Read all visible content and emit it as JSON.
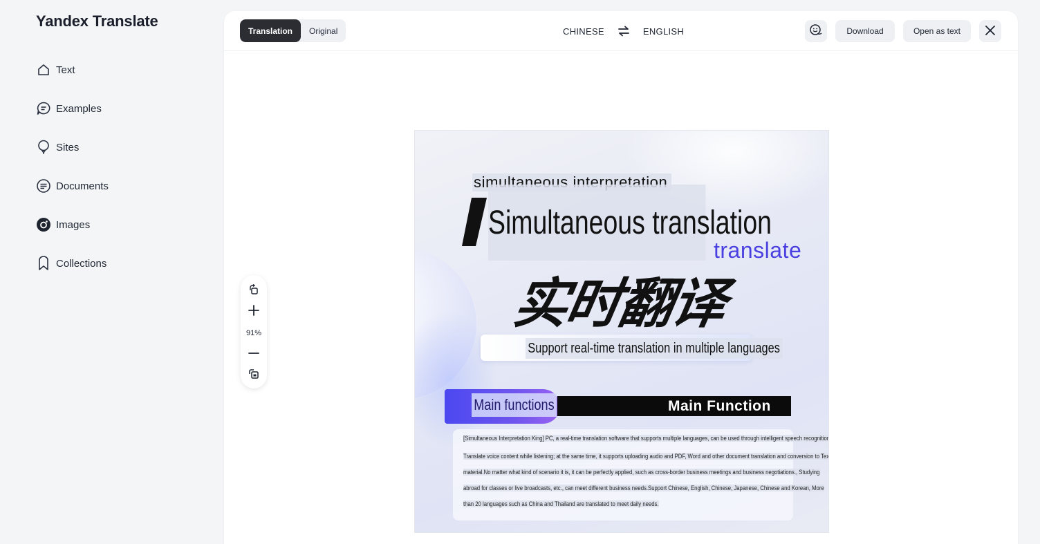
{
  "app": {
    "title": "Yandex Translate"
  },
  "sidebar": {
    "items": [
      {
        "label": "Text",
        "icon": "home-icon"
      },
      {
        "label": "Examples",
        "icon": "chat-bubble-icon"
      },
      {
        "label": "Sites",
        "icon": "balloon-icon"
      },
      {
        "label": "Documents",
        "icon": "document-icon"
      },
      {
        "label": "Images",
        "icon": "camera-icon",
        "active": true
      },
      {
        "label": "Collections",
        "icon": "bookmark-icon"
      }
    ]
  },
  "toolbar": {
    "view_translation": "Translation",
    "view_original": "Original",
    "source_lang": "CHINESE",
    "target_lang": "ENGLISH",
    "download_label": "Download",
    "open_text_label": "Open as text"
  },
  "zoom": {
    "level": "91%"
  },
  "image": {
    "line1": "simultaneous interpretation",
    "line2": "Simultaneous translation",
    "line3": "translate",
    "chinese_title": "实时翻译",
    "subtitle": "Support real-time translation in multiple languages",
    "main_functions_left": "Main functions",
    "main_functions_right": "Main Function",
    "body_lines": [
      "[Simultaneous Interpretation King] PC, a real-time translation software that supports multiple languages, can be used through intelligent speech recognition.",
      "Translate voice content while listening; at the same time, it supports uploading audio and PDF, Word and other document translation and conversion to Text",
      "material.No matter what kind of scenario it is, it can be perfectly applied, such as cross-border business meetings and business negotiations.,  Studying",
      "abroad for classes or live broadcasts, etc., can meet different business needs.Support Chinese, English, Chinese, Japanese, Chinese and Korean,  More",
      "than 20 languages such as China and Thailand are translated to meet daily needs."
    ]
  },
  "colors": {
    "accent_purple": "#4a3fe0",
    "dark": "#2b2d33"
  }
}
